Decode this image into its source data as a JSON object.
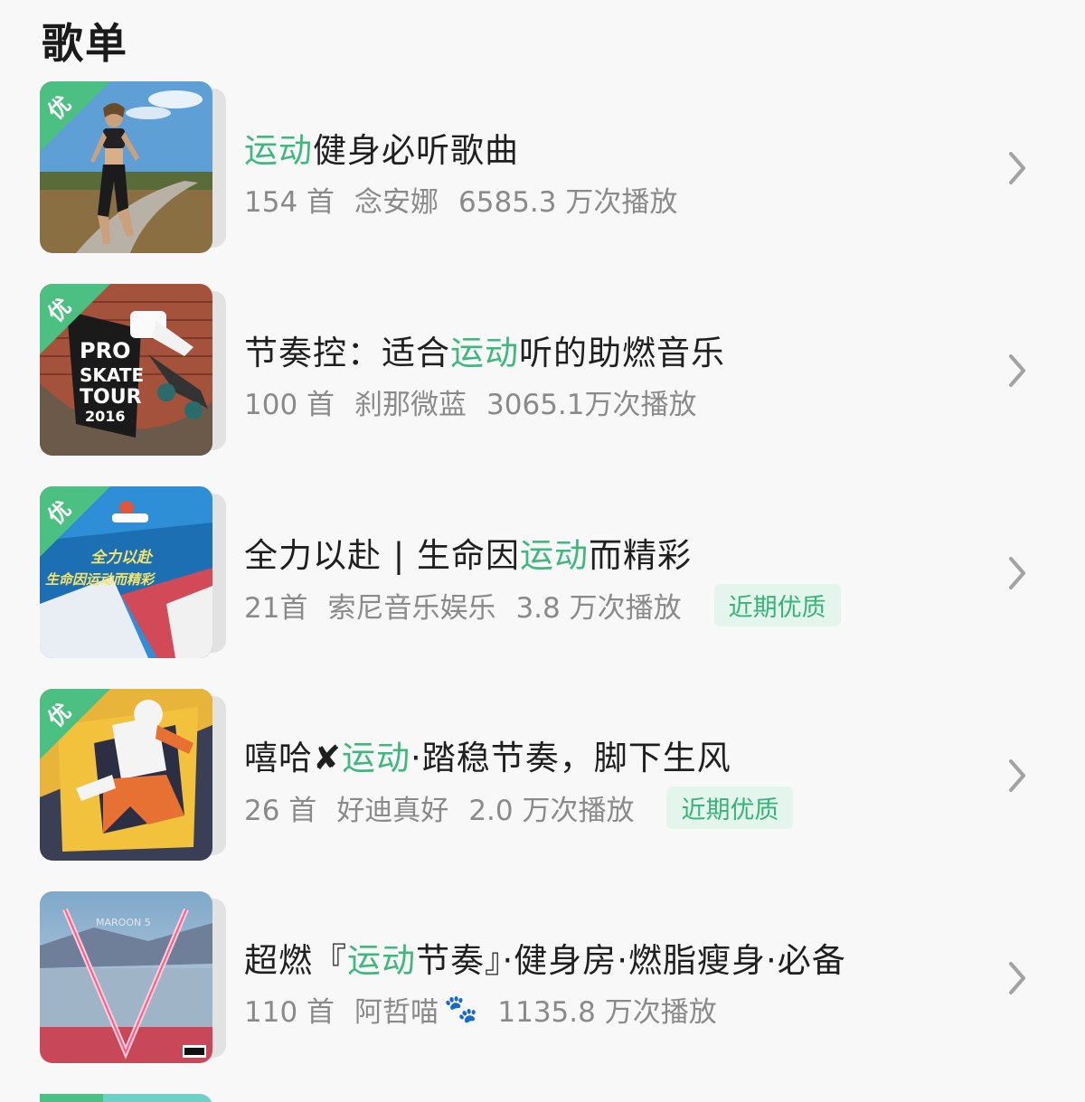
{
  "header": {
    "title": "歌单"
  },
  "playlists": [
    {
      "title_before": "",
      "title_highlight": "运动",
      "title_after": "健身必听歌曲",
      "count": "154 首",
      "author": "念安娜",
      "plays": "6585.3 万次播放",
      "badge": "",
      "vip": "优"
    },
    {
      "title_before": "节奏控：适合",
      "title_highlight": "运动",
      "title_after": "听的助燃音乐",
      "count": "100 首",
      "author": "刹那微蓝",
      "plays": "3065.1万次播放",
      "badge": "",
      "vip": "优",
      "cover_text": [
        "PRO",
        "SKATE",
        "TOUR",
        "2016"
      ]
    },
    {
      "title_before": "全力以赴 | 生命因",
      "title_highlight": "运动",
      "title_after": "而精彩",
      "count": "21首",
      "author": "索尼音乐娱乐",
      "plays": "3.8 万次播放",
      "badge": "近期优质",
      "vip": "优",
      "cover_text": [
        "全力以赴",
        "生命因运动而精彩"
      ]
    },
    {
      "title_before": "嘻哈✘",
      "title_highlight": "运动",
      "title_after": "·踏稳节奏，脚下生风",
      "count": "26 首",
      "author": "好迪真好",
      "plays": "2.0 万次播放",
      "badge": "近期优质",
      "vip": "优"
    },
    {
      "title_before": "超燃『",
      "title_highlight": "运动",
      "title_after": "节奏』·健身房·燃脂瘦身·必备",
      "count": "110 首",
      "author": "阿哲喵",
      "plays": "1135.8 万次播放",
      "badge": "",
      "vip": "",
      "cover_text": [
        "MAROON 5"
      ]
    }
  ],
  "icons": {
    "chevron": "chevron-right-icon",
    "paw": "🐾"
  },
  "colors": {
    "accent": "#3fb880",
    "vip": "#4cbf83",
    "badge_bg": "#e3f5ec"
  }
}
